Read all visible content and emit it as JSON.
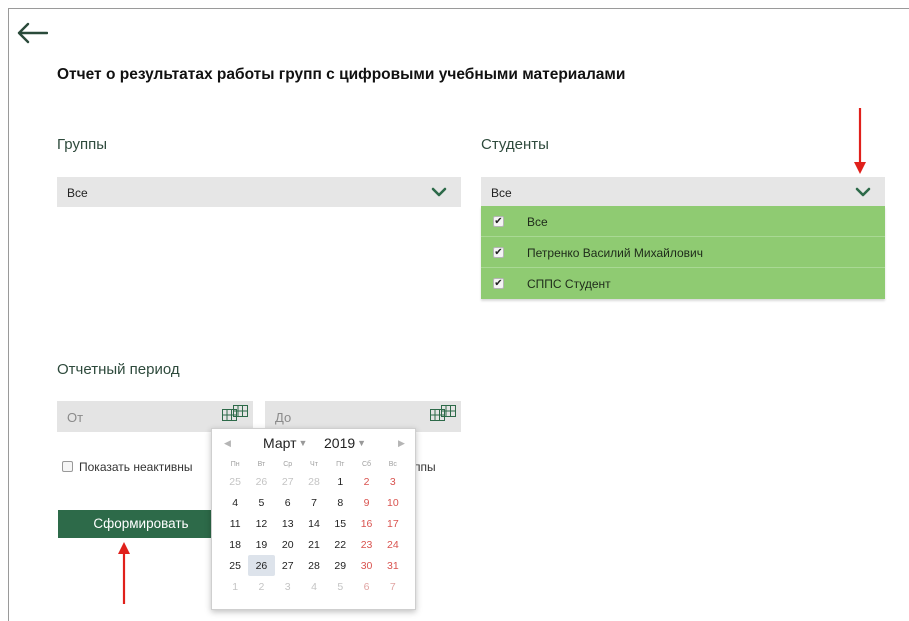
{
  "title": "Отчет о результатах работы групп с цифровыми учебными материалами",
  "groups": {
    "label": "Группы",
    "selected": "Все"
  },
  "students": {
    "label": "Студенты",
    "selected": "Все",
    "options": [
      {
        "label": "Все",
        "checked": true
      },
      {
        "label": "Петренко Василий Михайлович",
        "checked": true
      },
      {
        "label": "СППС Студент",
        "checked": true
      }
    ]
  },
  "period": {
    "label": "Отчетный период",
    "from_placeholder": "От",
    "to_placeholder": "До"
  },
  "show_inactive": {
    "label_start": "Показать неактивны",
    "label_end": "ппы",
    "checked": false
  },
  "submit_label": "Сформировать",
  "calendar": {
    "month": "Март",
    "year": "2019",
    "weekdays": [
      "Пн",
      "Вт",
      "Ср",
      "Чт",
      "Пт",
      "Сб",
      "Вс"
    ],
    "weeks": [
      [
        {
          "d": "25",
          "o": true
        },
        {
          "d": "26",
          "o": true
        },
        {
          "d": "27",
          "o": true
        },
        {
          "d": "28",
          "o": true
        },
        {
          "d": "1"
        },
        {
          "d": "2"
        },
        {
          "d": "3"
        }
      ],
      [
        {
          "d": "4"
        },
        {
          "d": "5"
        },
        {
          "d": "6"
        },
        {
          "d": "7"
        },
        {
          "d": "8"
        },
        {
          "d": "9"
        },
        {
          "d": "10"
        }
      ],
      [
        {
          "d": "11"
        },
        {
          "d": "12"
        },
        {
          "d": "13"
        },
        {
          "d": "14"
        },
        {
          "d": "15"
        },
        {
          "d": "16"
        },
        {
          "d": "17"
        }
      ],
      [
        {
          "d": "18"
        },
        {
          "d": "19"
        },
        {
          "d": "20"
        },
        {
          "d": "21"
        },
        {
          "d": "22"
        },
        {
          "d": "23"
        },
        {
          "d": "24"
        }
      ],
      [
        {
          "d": "25"
        },
        {
          "d": "26",
          "today": true
        },
        {
          "d": "27"
        },
        {
          "d": "28"
        },
        {
          "d": "29"
        },
        {
          "d": "30"
        },
        {
          "d": "31"
        }
      ],
      [
        {
          "d": "1",
          "o": true
        },
        {
          "d": "2",
          "o": true
        },
        {
          "d": "3",
          "o": true
        },
        {
          "d": "4",
          "o": true
        },
        {
          "d": "5",
          "o": true
        },
        {
          "d": "6",
          "o": true
        },
        {
          "d": "7",
          "o": true
        }
      ]
    ]
  },
  "colors": {
    "accent": "#2d6a49",
    "dropdown_bg": "#8fcb72",
    "weekend": "#d9534f",
    "annotation_arrow": "#e0201b"
  },
  "icons": {
    "back": "arrow-left-icon",
    "chevron": "chevron-down-icon",
    "calendar": "calendar-icon"
  }
}
